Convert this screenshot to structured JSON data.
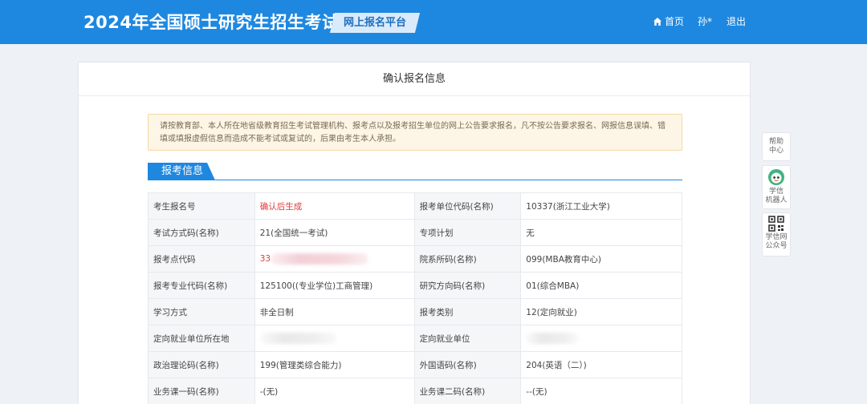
{
  "header": {
    "title": "2024年全国硕士研究生招生考试",
    "platform": "网上报名平台",
    "nav": {
      "home": "首页",
      "user": "孙*",
      "logout": "退出"
    }
  },
  "card": {
    "title": "确认报名信息"
  },
  "notice": "请按教育部、本人所在地省级教育招生考试管理机构、报考点以及报考招生单位的网上公告要求报名，凡不按公告要求报名、网报信息误填、错填或填报虚假信息而造成不能考试或复试的，后果由考生本人承担。",
  "section": {
    "title": "报考信息"
  },
  "rows": [
    {
      "k1": "考生报名号",
      "v1": "确认后生成",
      "k2": "报考单位代码(名称)",
      "v2": "10337(浙江工业大学)"
    },
    {
      "k1": "考试方式码(名称)",
      "v1": "21(全国统一考试)",
      "k2": "专项计划",
      "v2": "无"
    },
    {
      "k1": "报考点代码",
      "v1": "33",
      "k2": "院系所码(名称)",
      "v2": "099(MBA教育中心)"
    },
    {
      "k1": "报考专业代码(名称)",
      "v1": "125100((专业学位)工商管理)",
      "k2": "研究方向码(名称)",
      "v2": "01(综合MBA)"
    },
    {
      "k1": "学习方式",
      "v1": "非全日制",
      "k2": "报考类别",
      "v2": "12(定向就业)"
    },
    {
      "k1": "定向就业单位所在地",
      "v1": "",
      "k2": "定向就业单位",
      "v2": ""
    },
    {
      "k1": "政治理论码(名称)",
      "v1": "199(管理类综合能力)",
      "k2": "外国语码(名称)",
      "v2": "204(英语（二）)"
    },
    {
      "k1": "业务课一码(名称)",
      "v1": "-(无)",
      "k2": "业务课二码(名称)",
      "v2": "--(无)"
    }
  ],
  "sidebar": {
    "help": [
      "帮助",
      "中心"
    ],
    "robot": [
      "学信",
      "机器人"
    ],
    "qr": [
      "学信网",
      "公众号"
    ]
  },
  "colors": {
    "primary": "#1e88e0",
    "highlight": "#e23b3b",
    "notice_bg": "#fdf5e6"
  }
}
